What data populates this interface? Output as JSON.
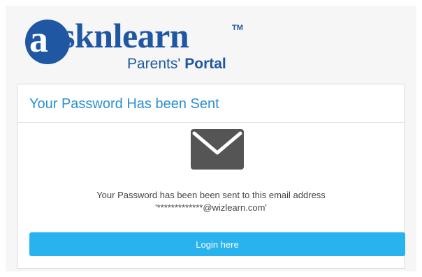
{
  "logo": {
    "mark_letter": "a",
    "word": "sknlearn",
    "tm": "TM",
    "sub_light": "Parents'",
    "sub_bold": "Portal",
    "brand_color": "#1f57a3"
  },
  "card": {
    "title": "Your Password Has been Sent",
    "icon": "envelope-icon",
    "message_line1": "Your Password has been been sent to this email address",
    "message_line2": "'*************@wizlearn.com'",
    "button_label": "Login here"
  },
  "colors": {
    "title": "#2c8fd1",
    "button": "#29b3ee",
    "icon": "#555555"
  }
}
